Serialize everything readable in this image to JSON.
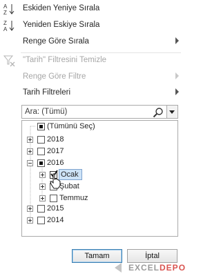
{
  "menu": {
    "sort_asc": {
      "label": "Eskiden Yeniye Sırala",
      "icon": "sort-ascending-icon"
    },
    "sort_desc": {
      "label": "Yeniden Eskiye Sırala",
      "icon": "sort-descending-icon"
    },
    "sort_color": {
      "label": "Renge Göre Sırala"
    },
    "clear_filter": {
      "label": "\"Tarih\" Filtresini Temizle",
      "icon": "clear-filter-icon"
    },
    "filter_color": {
      "label": "Renge Göre Filtre"
    },
    "date_filters": {
      "label": "Tarih Filtreleri"
    }
  },
  "search": {
    "placeholder": "Ara: (Tümü)"
  },
  "tree": {
    "select_all": "(Tümünü Seç)",
    "years": [
      {
        "label": "2018",
        "state": "unchecked",
        "expanded": false
      },
      {
        "label": "2017",
        "state": "unchecked",
        "expanded": false
      },
      {
        "label": "2016",
        "state": "partial",
        "expanded": true
      },
      {
        "label": "2015",
        "state": "unchecked",
        "expanded": false
      },
      {
        "label": "2014",
        "state": "unchecked",
        "expanded": false
      }
    ],
    "months_2016": [
      {
        "label": "Ocak",
        "state": "checked",
        "selected": true
      },
      {
        "label": "Şubat",
        "state": "unchecked"
      },
      {
        "label": "Temmuz",
        "state": "unchecked"
      }
    ]
  },
  "buttons": {
    "ok": "Tamam",
    "cancel": "İptal"
  },
  "watermark": {
    "pre": "EXCEL",
    "accent": "DEPO"
  }
}
